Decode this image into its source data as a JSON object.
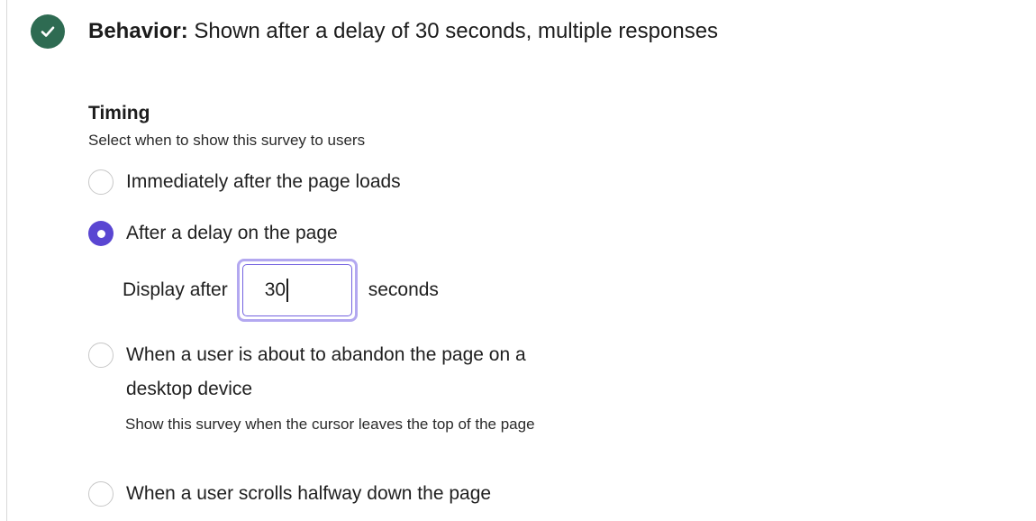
{
  "header": {
    "status": "complete",
    "label": "Behavior:",
    "summary": "Shown after a delay of 30 seconds, multiple responses",
    "icon": "check-icon",
    "icon_bg_color": "#2e6b52"
  },
  "timing": {
    "title": "Timing",
    "subtitle": "Select when to show this survey to users",
    "options": [
      {
        "label": "Immediately after the page loads",
        "selected": false
      },
      {
        "label": "After a delay on the page",
        "selected": true
      },
      {
        "label": "When a user is about to abandon the page on a desktop device",
        "help": "Show this survey when the cursor leaves the top of the page",
        "selected": false
      },
      {
        "label": "When a user scrolls halfway down the page",
        "selected": false
      }
    ],
    "delay": {
      "prefix": "Display after",
      "value": "30",
      "suffix": "seconds"
    }
  },
  "colors": {
    "accent": "#5a46d2",
    "focus_ring": "#b3a8f0"
  }
}
